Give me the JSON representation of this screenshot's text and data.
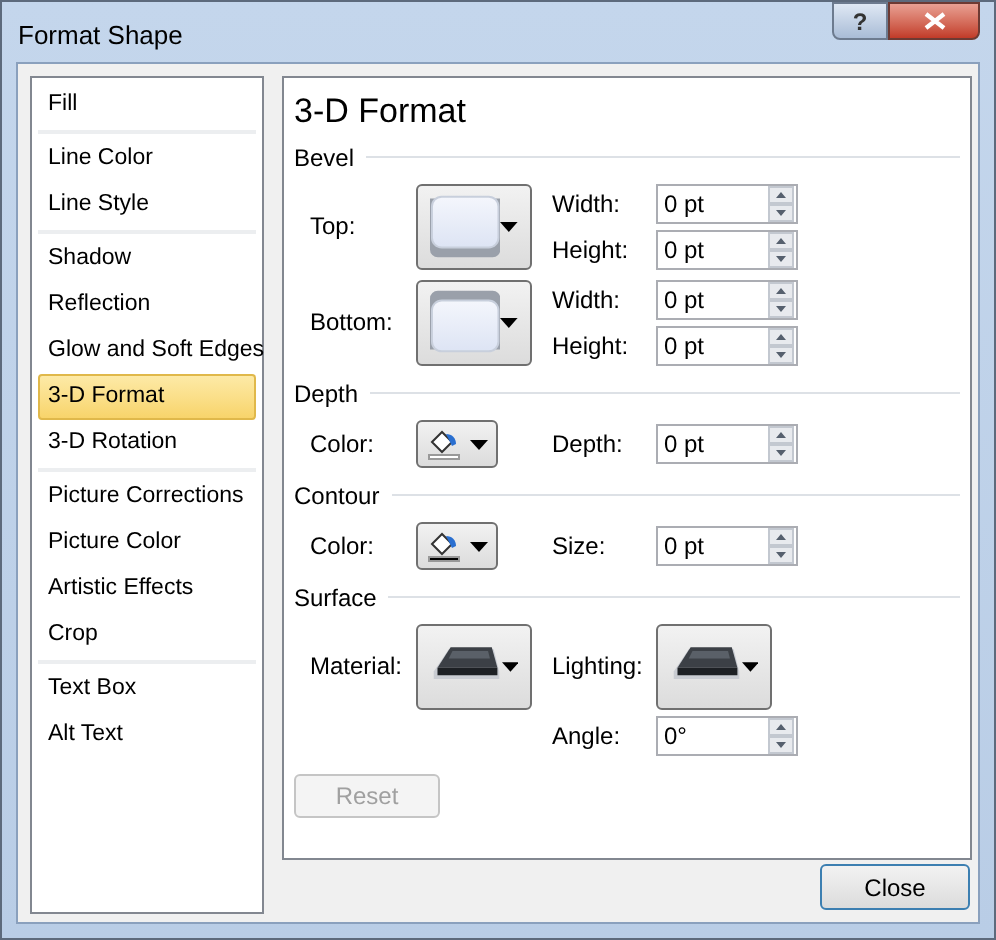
{
  "window": {
    "title": "Format Shape",
    "help_button": "?"
  },
  "sidebar": {
    "groups": [
      {
        "items": [
          {
            "label": "Fill",
            "selected": false
          }
        ]
      },
      {
        "items": [
          {
            "label": "Line Color",
            "selected": false
          },
          {
            "label": "Line Style",
            "selected": false
          }
        ]
      },
      {
        "items": [
          {
            "label": "Shadow",
            "selected": false
          },
          {
            "label": "Reflection",
            "selected": false
          },
          {
            "label": "Glow and Soft Edges",
            "selected": false
          },
          {
            "label": "3-D Format",
            "selected": true
          },
          {
            "label": "3-D Rotation",
            "selected": false
          }
        ]
      },
      {
        "items": [
          {
            "label": "Picture Corrections",
            "selected": false
          },
          {
            "label": "Picture Color",
            "selected": false
          },
          {
            "label": "Artistic Effects",
            "selected": false
          },
          {
            "label": "Crop",
            "selected": false
          }
        ]
      },
      {
        "items": [
          {
            "label": "Text Box",
            "selected": false
          },
          {
            "label": "Alt Text",
            "selected": false
          }
        ]
      }
    ]
  },
  "panel": {
    "title": "3-D Format",
    "sections": [
      {
        "heading": "Bevel",
        "rows": [
          {
            "kind": "bevel",
            "label": "Top:",
            "fields": [
              {
                "label": "Width:",
                "value": "0 pt"
              },
              {
                "label": "Height:",
                "value": "0 pt"
              }
            ]
          },
          {
            "kind": "bevel",
            "label": "Bottom:",
            "fields": [
              {
                "label": "Width:",
                "value": "0 pt"
              },
              {
                "label": "Height:",
                "value": "0 pt"
              }
            ]
          }
        ]
      },
      {
        "heading": "Depth",
        "rows": [
          {
            "kind": "color",
            "label": "Color:",
            "color": "#ffffff",
            "fields": [
              {
                "label": "Depth:",
                "value": "0 pt"
              }
            ]
          }
        ]
      },
      {
        "heading": "Contour",
        "rows": [
          {
            "kind": "color",
            "label": "Color:",
            "color": "#000000",
            "fields": [
              {
                "label": "Size:",
                "value": "0 pt"
              }
            ]
          }
        ]
      },
      {
        "heading": "Surface",
        "rows": [
          {
            "kind": "surface",
            "label": "Material:",
            "second_label": "Lighting:"
          },
          {
            "kind": "field",
            "fields": [
              {
                "label": "Angle:",
                "value": "0°"
              }
            ]
          }
        ]
      }
    ],
    "reset": {
      "label": "Reset",
      "disabled": true
    }
  },
  "close_button": "Close"
}
